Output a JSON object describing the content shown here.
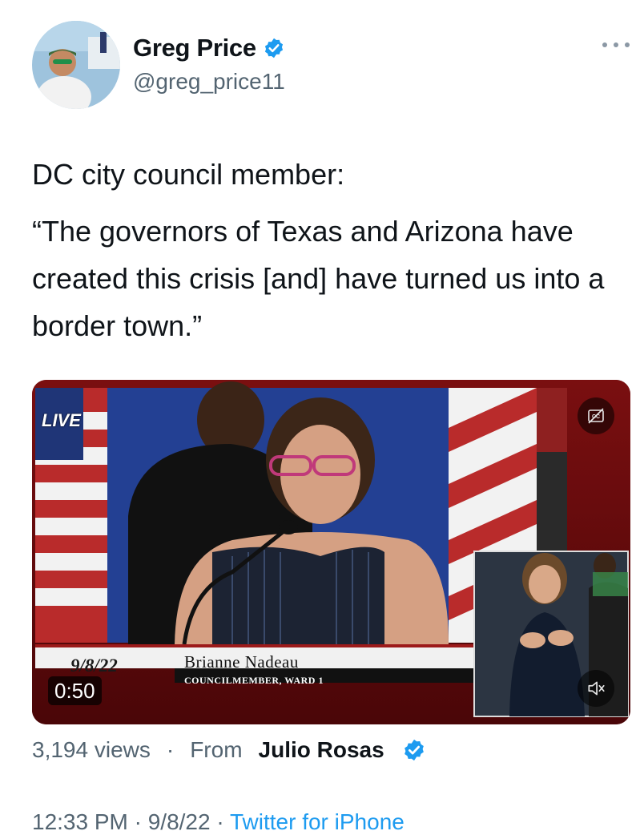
{
  "author": {
    "display_name": "Greg Price",
    "handle": "@greg_price11",
    "verified": true,
    "avatar_icon": "profile-photo"
  },
  "more_icon": "ellipsis-icon",
  "tweet": {
    "line1": "DC city council member:",
    "line2": "“The governors of Texas and Arizona have created this crisis [and] have turned us into a border town.”"
  },
  "video": {
    "live_label": "LIVE",
    "date": "9/8/22",
    "speaker_name": "Brianne Nadeau",
    "speaker_title": "COUNCILMEMBER, WARD 1",
    "duration": "0:50",
    "cc_icon": "closed-captions-icon",
    "mute_icon": "muted-speaker-icon"
  },
  "meta": {
    "views": "3,194 views",
    "separator": "·",
    "from_label": "From",
    "from_name": "Julio Rosas",
    "from_verified": true
  },
  "footer": {
    "time": "12:33 PM · 9/8/22 · ",
    "source": "Twitter for iPhone"
  },
  "colors": {
    "verified_blue": "#1d9bf0",
    "secondary_text": "#536471",
    "primary_text": "#0f1419"
  }
}
